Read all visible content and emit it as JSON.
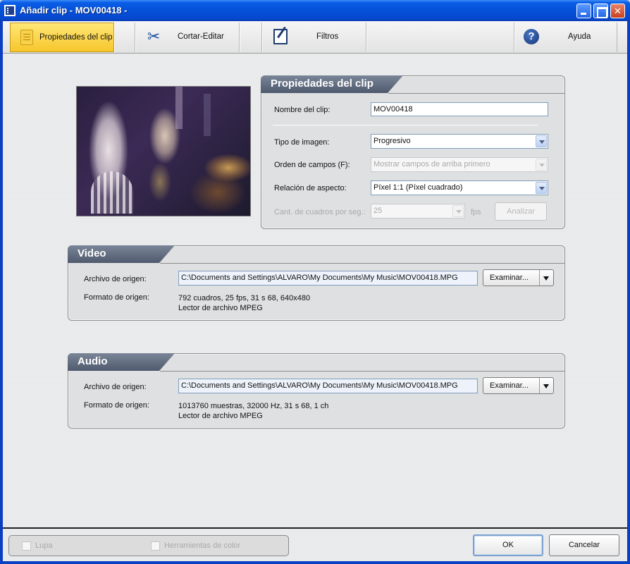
{
  "window": {
    "title": "Añadir clip - MOV00418 -"
  },
  "toolbar": {
    "tabs": [
      {
        "label": "Propiedades del clip",
        "icon": "document-icon"
      },
      {
        "label": "Cortar-Editar",
        "icon": "scissors-icon"
      },
      {
        "label": "Filtros",
        "icon": "filter-edit-icon"
      }
    ],
    "help_label": "Ayuda",
    "help_icon_glyph": "?"
  },
  "clip_properties": {
    "tab_title": "Propiedades del clip",
    "clip_name_label": "Nombre del clip:",
    "clip_name_value": "MOV00418",
    "image_type_label": "Tipo de imagen:",
    "image_type_value": "Progresivo",
    "field_order_label": "Orden de campos (F):",
    "field_order_value": "Mostrar campos de arriba primero",
    "aspect_label": "Relación de aspecto:",
    "aspect_value": "Píxel 1:1 (Píxel cuadrado)",
    "frames_label": "Cant. de cuadros por seg.:",
    "frames_value": "25",
    "fps_unit": "fps",
    "analyze_label": "Analizar"
  },
  "video": {
    "tab_title": "Video",
    "source_label": "Archivo de origen:",
    "source_path": "C:\\Documents and Settings\\ALVARO\\My Documents\\My Music\\MOV00418.MPG",
    "browse_label": "Examinar...",
    "format_label": "Formato de origen:",
    "format_line1": "792 cuadros,  25  fps,  31 s 68,  640x480",
    "format_line2": "Lector de archivo MPEG"
  },
  "audio": {
    "tab_title": "Audio",
    "source_label": "Archivo de origen:",
    "source_path": "C:\\Documents and Settings\\ALVARO\\My Documents\\My Music\\MOV00418.MPG",
    "browse_label": "Examinar...",
    "format_label": "Formato de origen:",
    "format_line1": "1013760 muestras,  32000  Hz,  31 s 68,  1 ch",
    "format_line2": "Lector de archivo MPEG"
  },
  "footer": {
    "lupa_label": "Lupa",
    "color_tools_label": "Herramientas de color",
    "ok_label": "OK",
    "cancel_label": "Cancelar"
  }
}
